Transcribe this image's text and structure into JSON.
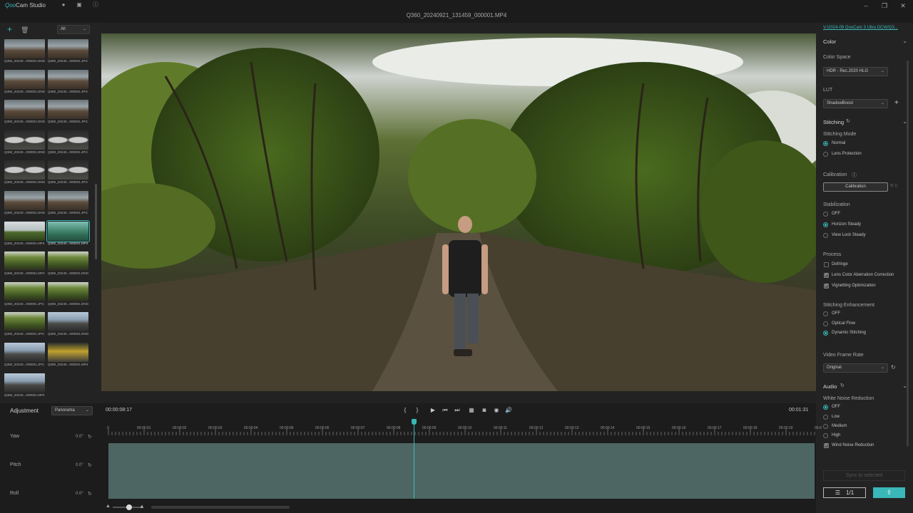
{
  "app": {
    "title_prefix": "Qoo",
    "title_rest": "Cam Studio"
  },
  "document": {
    "title": "Q360_20240921_131459_000001.MP4"
  },
  "media": {
    "filter": "All",
    "items": [
      {
        "label": "Q360_20240...000001.DNG",
        "style": "dark"
      },
      {
        "label": "Q360_20240...000001.JPG",
        "style": "dark"
      },
      {
        "label": "Q360_20240...000001.DNG",
        "style": "dark"
      },
      {
        "label": "Q360_20240...000001.JPG",
        "style": "dark"
      },
      {
        "label": "Q360_20240...000001.DNG",
        "style": "dark"
      },
      {
        "label": "Q360_20240...000001.JPG",
        "style": "dark"
      },
      {
        "label": "Q360_20240...000001.DNG",
        "style": "room"
      },
      {
        "label": "Q360_20240...000001.JPG",
        "style": "room"
      },
      {
        "label": "Q360_20240...000001.DNG",
        "style": "room"
      },
      {
        "label": "Q360_20240...000001.JPG",
        "style": "room"
      },
      {
        "label": "Q360_20240...000001.DNG",
        "style": "dark"
      },
      {
        "label": "Q360_20240...000001.JPG",
        "style": "dark"
      },
      {
        "label": "Q360_20240...000001.MP4",
        "style": "field"
      },
      {
        "label": "Q360_20240...000001.MP4",
        "style": "teal",
        "selected": true
      },
      {
        "label": "Q360_20240...000001.MP4",
        "style": "forest"
      },
      {
        "label": "Q360_20240...000001.DNG",
        "style": "forest"
      },
      {
        "label": "Q360_20240...000001.JPG",
        "style": "forest"
      },
      {
        "label": "Q360_20240...000001.DNG",
        "style": "forest"
      },
      {
        "label": "Q360_20240...000001.JPG",
        "style": "forest"
      },
      {
        "label": "Q360_20240...000001.DNG",
        "style": "road"
      },
      {
        "label": "Q360_20240...000001.JPG",
        "style": "road"
      },
      {
        "label": "Q360_20240...000001.MP4",
        "style": "sunset"
      },
      {
        "label": "Q360_20240...000001.MP4",
        "style": "road"
      }
    ]
  },
  "right_panel": {
    "location_link": "V:/2024-09 QooCam 3 Ultra DCW/Q3...",
    "color": {
      "header": "Color",
      "color_space_label": "Color Space",
      "color_space_value": "HDR - Rec.2020 HLG",
      "lut_label": "LUT",
      "lut_value": "ShadowBoost"
    },
    "stitching": {
      "header": "Stitching",
      "mode_label": "Stitching Mode",
      "modes": [
        "Normal",
        "Lens Protection"
      ],
      "calibration_label": "Calibration",
      "calibration_button": "Calibration",
      "stabilization_label": "Stabilization",
      "stabilization_options": [
        "OFF",
        "Horizon Steady",
        "View Lock Steady"
      ],
      "process_label": "Process",
      "process_options": [
        "Defringe",
        "Lens Color Aberration Correction",
        "Vignetting Optimization"
      ],
      "enhancement_label": "Stitching Enhancement",
      "enhancement_options": [
        "OFF",
        "Optical Flow",
        "Dynamic Stitching"
      ],
      "frame_rate_label": "Video Frame Rate",
      "frame_rate_value": "Original"
    },
    "audio": {
      "header": "Audio",
      "wnr_label": "White Noise Reduction",
      "wnr_options": [
        "OFF",
        "Low",
        "Medium",
        "High"
      ],
      "wind_label": "Wind Noise Reduction"
    },
    "sync_button": "Sync to selected",
    "queue_label": "1/1"
  },
  "bottom": {
    "adjustment_label": "Adjustment",
    "adjustment_mode": "Panorama",
    "current_time": "00:00:08:17",
    "total_time": "00:01:31",
    "params": [
      {
        "name": "Yaw",
        "value": "0.0°"
      },
      {
        "name": "Pitch",
        "value": "0.0°"
      },
      {
        "name": "Roll",
        "value": "0.0°"
      }
    ],
    "ruler_labels": [
      "0",
      "00:00:01",
      "00:00:02",
      "00:00:03",
      "00:00:04",
      "00:00:05",
      "00:00:06",
      "00:00:07",
      "00:00:08",
      "00:00:09",
      "00:00:10",
      "00:00:11",
      "00:00:12",
      "00:00:13",
      "00:00:14",
      "00:00:15",
      "00:00:16",
      "00:00:17",
      "00:00:18",
      "00:00:19",
      "00:0"
    ]
  },
  "colors": {
    "accent": "#3ab7b8",
    "panel": "#232323",
    "track": "#4d6663"
  }
}
